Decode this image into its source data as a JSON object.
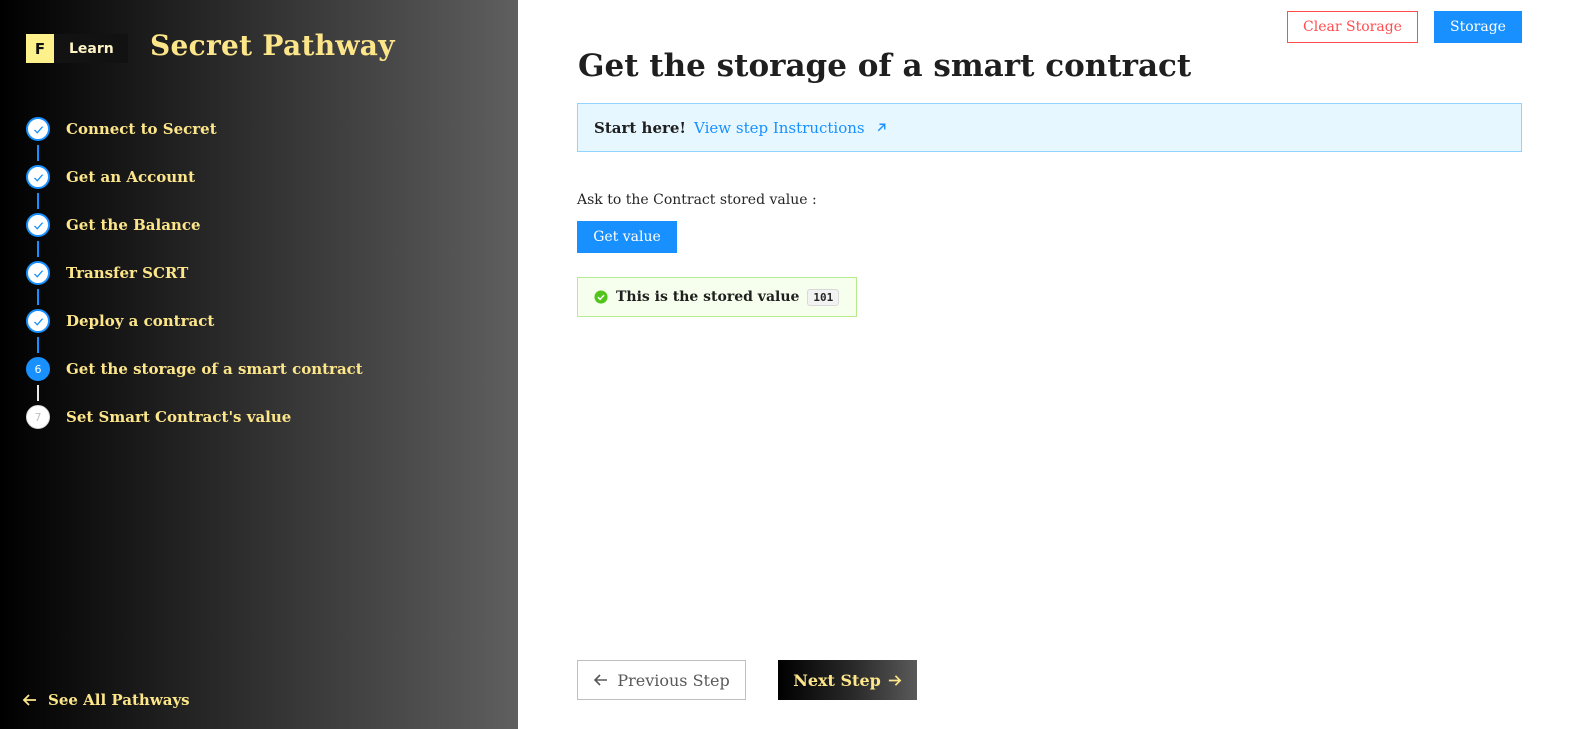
{
  "brand": {
    "logo_letter": "F",
    "logo_text": "Learn",
    "pathway_title": "Secret Pathway"
  },
  "sidebar": {
    "steps": [
      {
        "number": "1",
        "label": "Connect to Secret",
        "status": "done"
      },
      {
        "number": "2",
        "label": "Get an Account",
        "status": "done"
      },
      {
        "number": "3",
        "label": "Get the Balance",
        "status": "done"
      },
      {
        "number": "4",
        "label": "Transfer SCRT",
        "status": "done"
      },
      {
        "number": "5",
        "label": "Deploy a contract",
        "status": "done"
      },
      {
        "number": "6",
        "label": "Get the storage of a smart contract",
        "status": "current"
      },
      {
        "number": "7",
        "label": "Set Smart Contract's value",
        "status": "pending"
      }
    ],
    "see_all_label": "See All Pathways"
  },
  "header": {
    "clear_storage_label": "Clear Storage",
    "storage_label": "Storage"
  },
  "main": {
    "title": "Get the storage of a smart contract",
    "info": {
      "strong": "Start here!",
      "link_label": "View step Instructions"
    },
    "ask_label": "Ask to the Contract stored value :",
    "get_value_label": "Get value",
    "result": {
      "text": "This is the stored value",
      "value": "101"
    }
  },
  "nav": {
    "previous_label": "Previous Step",
    "next_label": "Next Step"
  },
  "colors": {
    "accent": "#1890ff",
    "sidebar_text": "#fde68a",
    "danger": "#ff4d4f",
    "success": "#52c41a"
  }
}
